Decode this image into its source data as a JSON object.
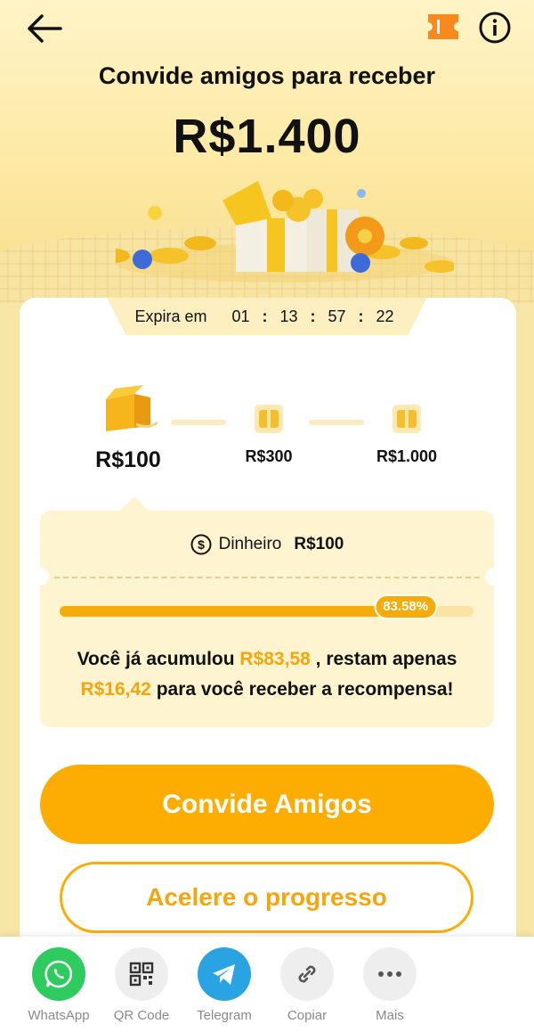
{
  "header": {
    "title": "Convide amigos para receber",
    "amount": "R$1.400"
  },
  "countdown": {
    "label": "Expira em",
    "days": "01",
    "hours": "13",
    "minutes": "57",
    "seconds": "22"
  },
  "milestones": [
    {
      "label": "R$100",
      "active": true
    },
    {
      "label": "R$300",
      "active": false
    },
    {
      "label": "R$1.000",
      "active": false
    }
  ],
  "reward": {
    "cash_label": "Dinheiro",
    "cash_value": "R$100",
    "progress_percent": 83.58,
    "progress_label": "83.58%",
    "msg_part1": "Você já acumulou ",
    "accumulated": "R$83,58",
    "msg_part2": " , restam apenas ",
    "remaining": "R$16,42",
    "msg_part3": " para você receber a recompensa!"
  },
  "buttons": {
    "invite": "Convide Amigos",
    "accelerate": "Acelere o progresso"
  },
  "share": [
    {
      "label": "WhatsApp",
      "icon": "whatsapp-icon",
      "color": "#2ecc5e"
    },
    {
      "label": "QR Code",
      "icon": "qr-code-icon",
      "color": "#eeeeee"
    },
    {
      "label": "Telegram",
      "icon": "telegram-icon",
      "color": "#2aa3e3"
    },
    {
      "label": "Copiar",
      "icon": "link-icon",
      "color": "#eeeeee"
    },
    {
      "label": "Mais",
      "icon": "more-icon",
      "color": "#eeeeee"
    }
  ],
  "colors": {
    "accent": "#fdad02",
    "highlight": "#f5a60c",
    "background": "#f7e6a6"
  }
}
